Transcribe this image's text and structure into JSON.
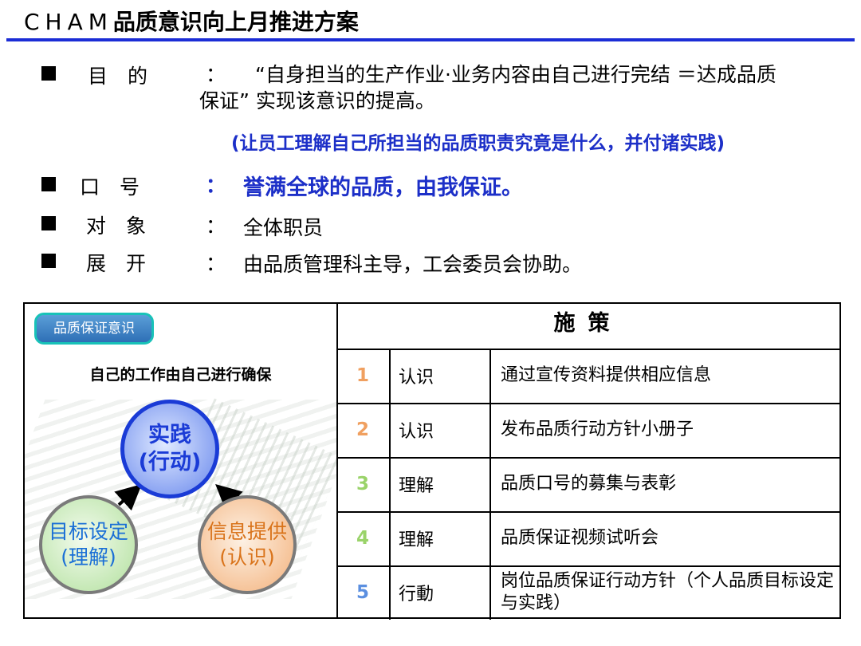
{
  "header": {
    "title_prefix": "CHAM",
    "title_main": "品质意识向上月推进方案"
  },
  "info": {
    "purpose_label": "目　的",
    "purpose_line1": "“自身担当的生产作业·业务内容由自己进行完结 ＝达成品质",
    "purpose_line2": "保证” 实现该意识的提高。",
    "purpose_note": "(让员工理解自己所担当的品质职责究竟是什么，并付诸实践)",
    "slogan_label": "口　号",
    "slogan_value": "誉满全球的品质，由我保证。",
    "target_label": "对　象",
    "target_value": "全体职员",
    "expand_label": "展　开",
    "expand_value": "由品质管理科主导，工会委员会协助。",
    "colon": "："
  },
  "diagram": {
    "badge": "品质保证意识",
    "heading": "自己的工作由自己进行确保",
    "top_line1": "实践",
    "top_line2": "(行动)",
    "left_line1": "目标设定",
    "left_line2": "(理解)",
    "right_line1": "信息提供",
    "right_line2": "(认识)"
  },
  "measures": {
    "header": "施策",
    "rows": [
      {
        "num": "1",
        "num_color": "#f0a060",
        "category": "认识",
        "desc": "通过宣传资料提供相应信息"
      },
      {
        "num": "2",
        "num_color": "#f0a060",
        "category": "认识",
        "desc": "发布品质行动方针小册子"
      },
      {
        "num": "3",
        "num_color": "#9ad36a",
        "category": "理解",
        "desc": "品质口号的募集与表彰"
      },
      {
        "num": "4",
        "num_color": "#9ad36a",
        "category": "理解",
        "desc": "品质保证视频试听会"
      },
      {
        "num": "5",
        "num_color": "#5b8fe0",
        "category": "行動",
        "desc": "岗位品质保证行动方针（个人品质目标设定与实践）"
      }
    ]
  },
  "colors": {
    "accent_blue": "#1c2fc8",
    "rule_blue": "#1b2dd6"
  }
}
